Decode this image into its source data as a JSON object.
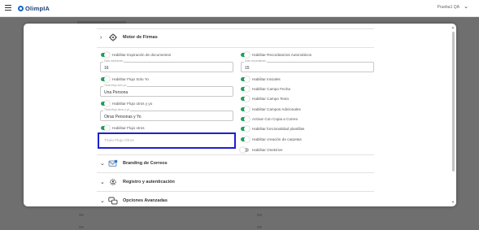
{
  "app": {
    "logo_text": "OlimpIA",
    "user_name": "Prueba1 QA"
  },
  "sections": {
    "motor_firmas": "Motor de Firmas",
    "branding": "Branding de Correos",
    "registro": "Registro y autenticación",
    "opciones": "Opciones Avanzadas"
  },
  "left_column": {
    "t1_label": "Habilitar Expiración de documentos",
    "f1_label": "Días expiración",
    "f1_value": "16",
    "t2_label": "Habilitar Flujo Solo Yo",
    "f2_label": "Título flujo solo yo",
    "f2_value": "Una Persona",
    "t3_label": "Habilitar Flujo otros y yo",
    "f3_label": "Título flujo otros y yo",
    "f3_value": "Otras Personas y Yo",
    "t4_label": "Habilitar Flujo otros",
    "f4_placeholder": "Título Flujo Otros"
  },
  "right_column": {
    "t1_label": "Habilitar Recordatorios Automáticos",
    "f1_label": "Días recordatorio",
    "f1_value": "15",
    "t2_label": "Habilitar Iniciales",
    "t3_label": "Habilitar Campo Fecha",
    "t4_label": "Habilitar Campo Texto",
    "t5_label": "Habilitar Campos Adicionales",
    "t6_label": "Activar Con Copia a Correo",
    "t7_label": "Habilitar funcionalidad plantillas",
    "t8_label": "Habilitar creación de carpetas",
    "t9_label": "Habilitar OneDrive"
  },
  "toggle_states": {
    "left_t1": true,
    "left_t2": true,
    "left_t3": true,
    "left_t4": true,
    "right_t1": true,
    "right_t2": true,
    "right_t3": true,
    "right_t4": true,
    "right_t5": true,
    "right_t6": true,
    "right_t7": true,
    "right_t8": true,
    "right_t9": false
  },
  "icons": {
    "menu": "hamburger-icon",
    "user_menu": "chevron-down-icon",
    "section_expand": "chevron-down-icon",
    "motor": "signature-engine-icon",
    "branding": "mail-icon",
    "registro": "gear-person-icon",
    "opciones": "chat-bubbles-icon"
  },
  "colors": {
    "toggle_on": "#1fa35c",
    "toggle_off": "#bdbdbd",
    "focus_outline": "#1f1fd1",
    "brand": "#1769c2"
  }
}
